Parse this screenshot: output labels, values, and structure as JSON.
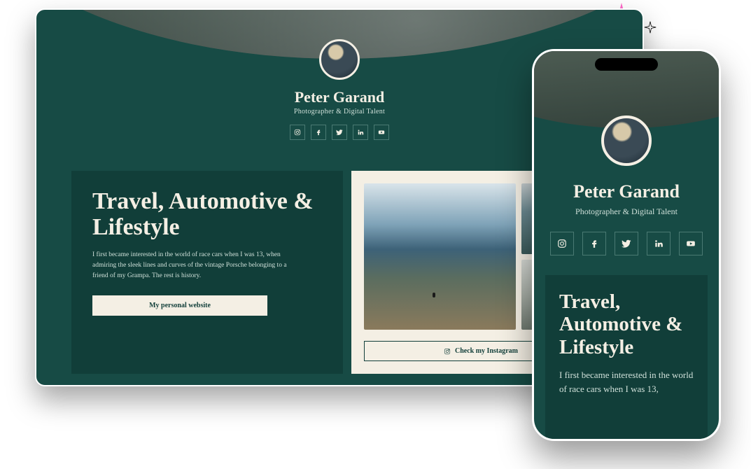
{
  "profile": {
    "name": "Peter Garand",
    "subtitle": "Photographer & Digital Talent"
  },
  "social": {
    "instagram": "instagram",
    "facebook": "facebook",
    "twitter": "twitter",
    "linkedin": "linkedin",
    "youtube": "youtube"
  },
  "content": {
    "headline": "Travel, Automotive & Lifestyle",
    "bio": "I first became interested in the world of race cars when I was 13, when admiring the sleek lines and curves of the vintage Porsche belonging to a friend of my Grampa. The rest is history.",
    "bio_short": "I first became interested in the world of race cars when I was 13,",
    "website_cta": "My personal website",
    "instagram_cta": "Check my Instagram"
  }
}
